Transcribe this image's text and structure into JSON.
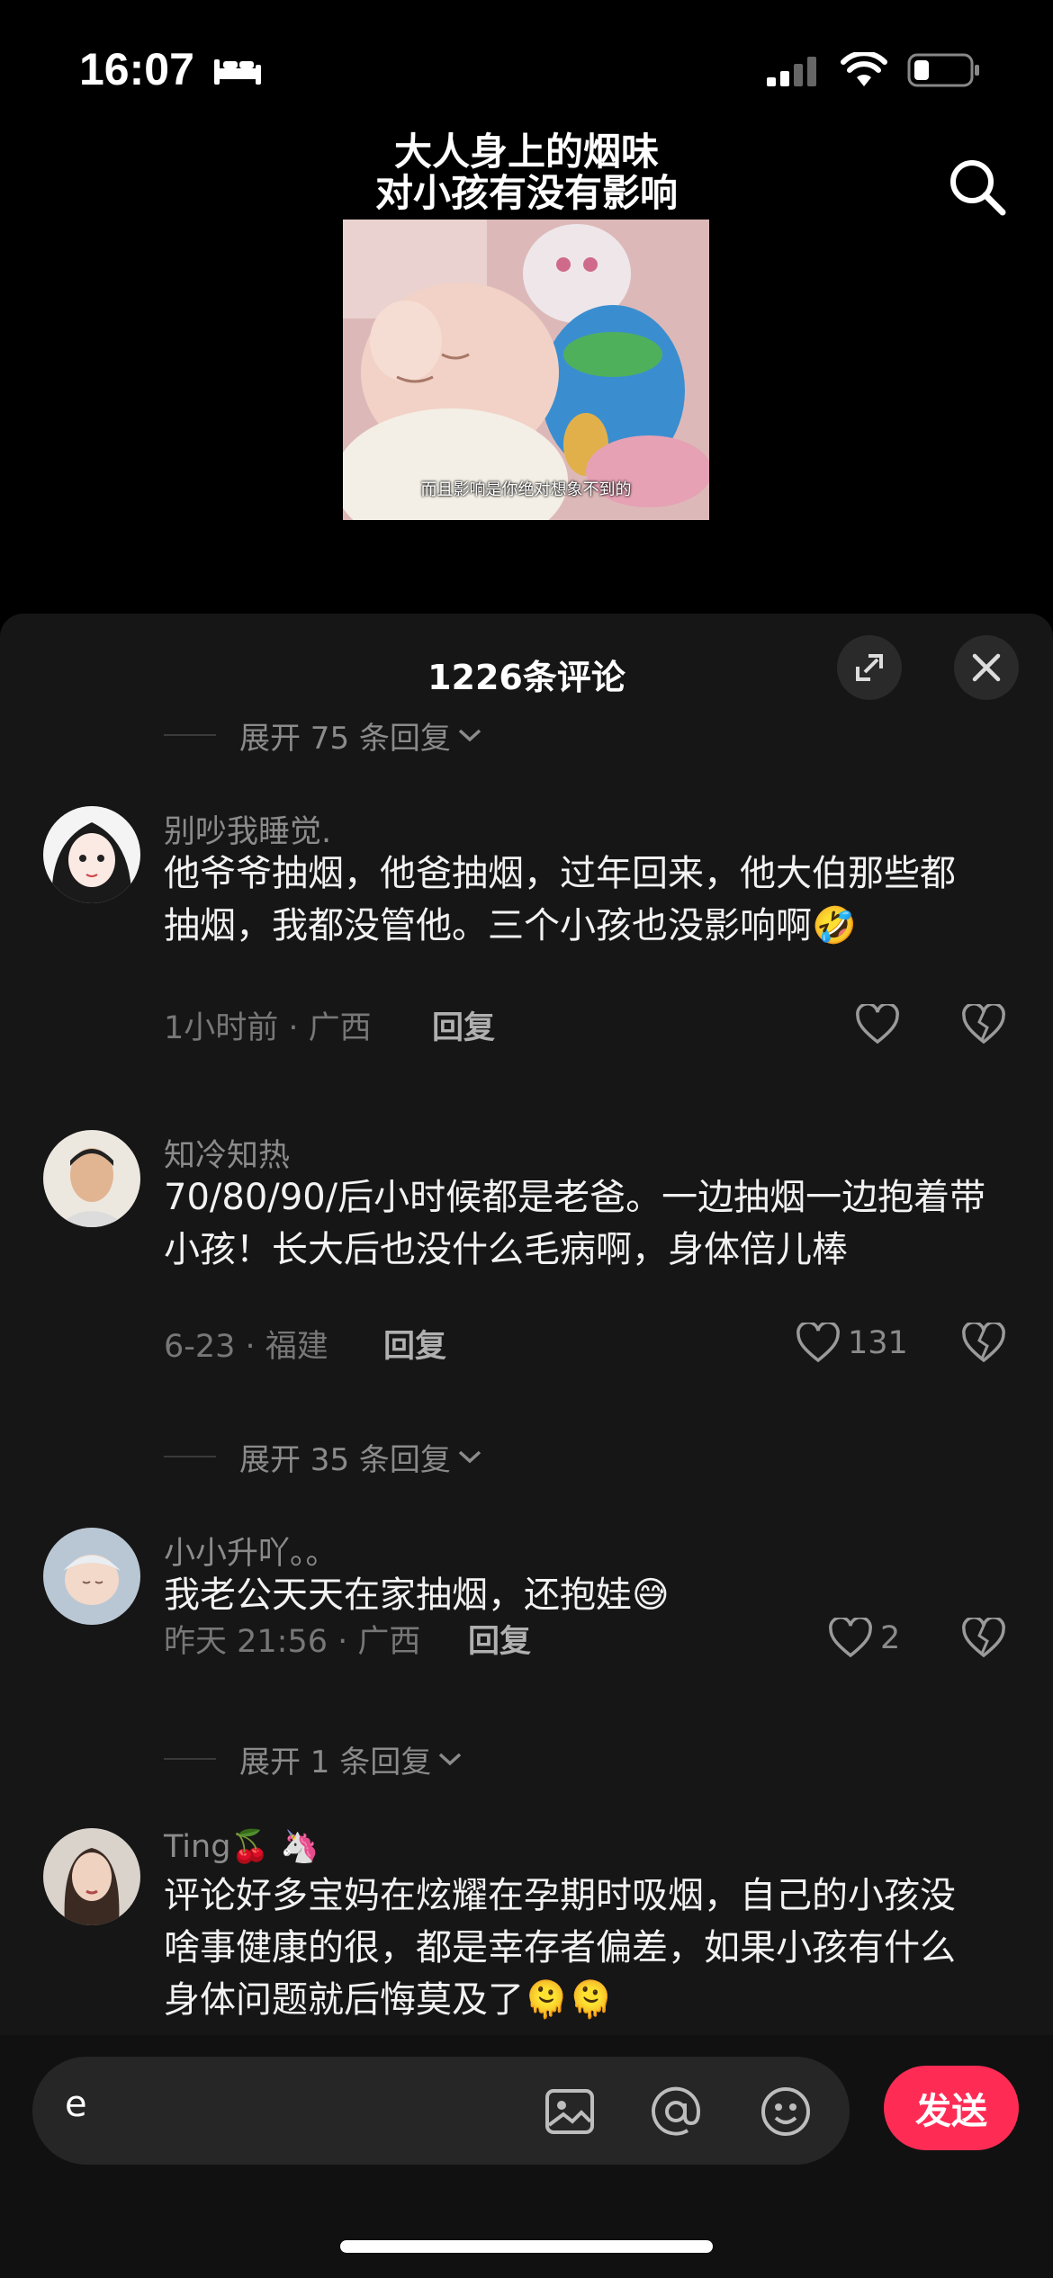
{
  "status_bar": {
    "time": "16:07"
  },
  "video": {
    "title_line1": "大人身上的烟味",
    "title_line2": "对小孩有没有影响",
    "caption": "而且影响是你绝对想象不到的"
  },
  "panel": {
    "title": "1226条评论",
    "expand_top": "展开 75 条回复",
    "expand_mid": "展开 35 条回复",
    "expand_low": "展开 1 条回复"
  },
  "comments": [
    {
      "name": "别吵我睡觉.",
      "text": "他爷爷抽烟，他爸抽烟，过年回来，他大伯那些都抽烟，我都没管他。三个小孩也没影响啊🤣",
      "meta": "1小时前 · 广西",
      "reply": "回复",
      "likes": ""
    },
    {
      "name": "知冷知热",
      "text": "70/80/90/后小时候都是老爸。一边抽烟一边抱着带小孩！长大后也没什么毛病啊，身体倍儿棒",
      "meta": "6-23 · 福建",
      "reply": "回复",
      "likes": "131"
    },
    {
      "name": "小小升吖。。",
      "text": "我老公天天在家抽烟，还抱娃😅",
      "meta": "昨天 21:56 · 广西",
      "reply": "回复",
      "likes": "2"
    },
    {
      "name": "Ting🍒 🦄",
      "text": "评论好多宝妈在炫耀在孕期时吸烟，自己的小孩没啥事健康的很，都是幸存者偏差，如果小孩有什么身体问题就后悔莫及了🫠🫠",
      "meta": "",
      "reply": "",
      "likes": ""
    }
  ],
  "input_bar": {
    "value": "e",
    "send_label": "发送"
  },
  "colors": {
    "send": "#fe2c55",
    "panel_bg": "#161616",
    "muted_text": "#8b8b8b"
  },
  "icons": [
    "bed-icon",
    "signal-icon",
    "wifi-icon",
    "battery-icon",
    "search-icon",
    "expand-icon",
    "close-icon",
    "heart-icon",
    "broken-heart-icon",
    "image-icon",
    "at-icon",
    "emoji-icon",
    "chevron-down-icon"
  ]
}
